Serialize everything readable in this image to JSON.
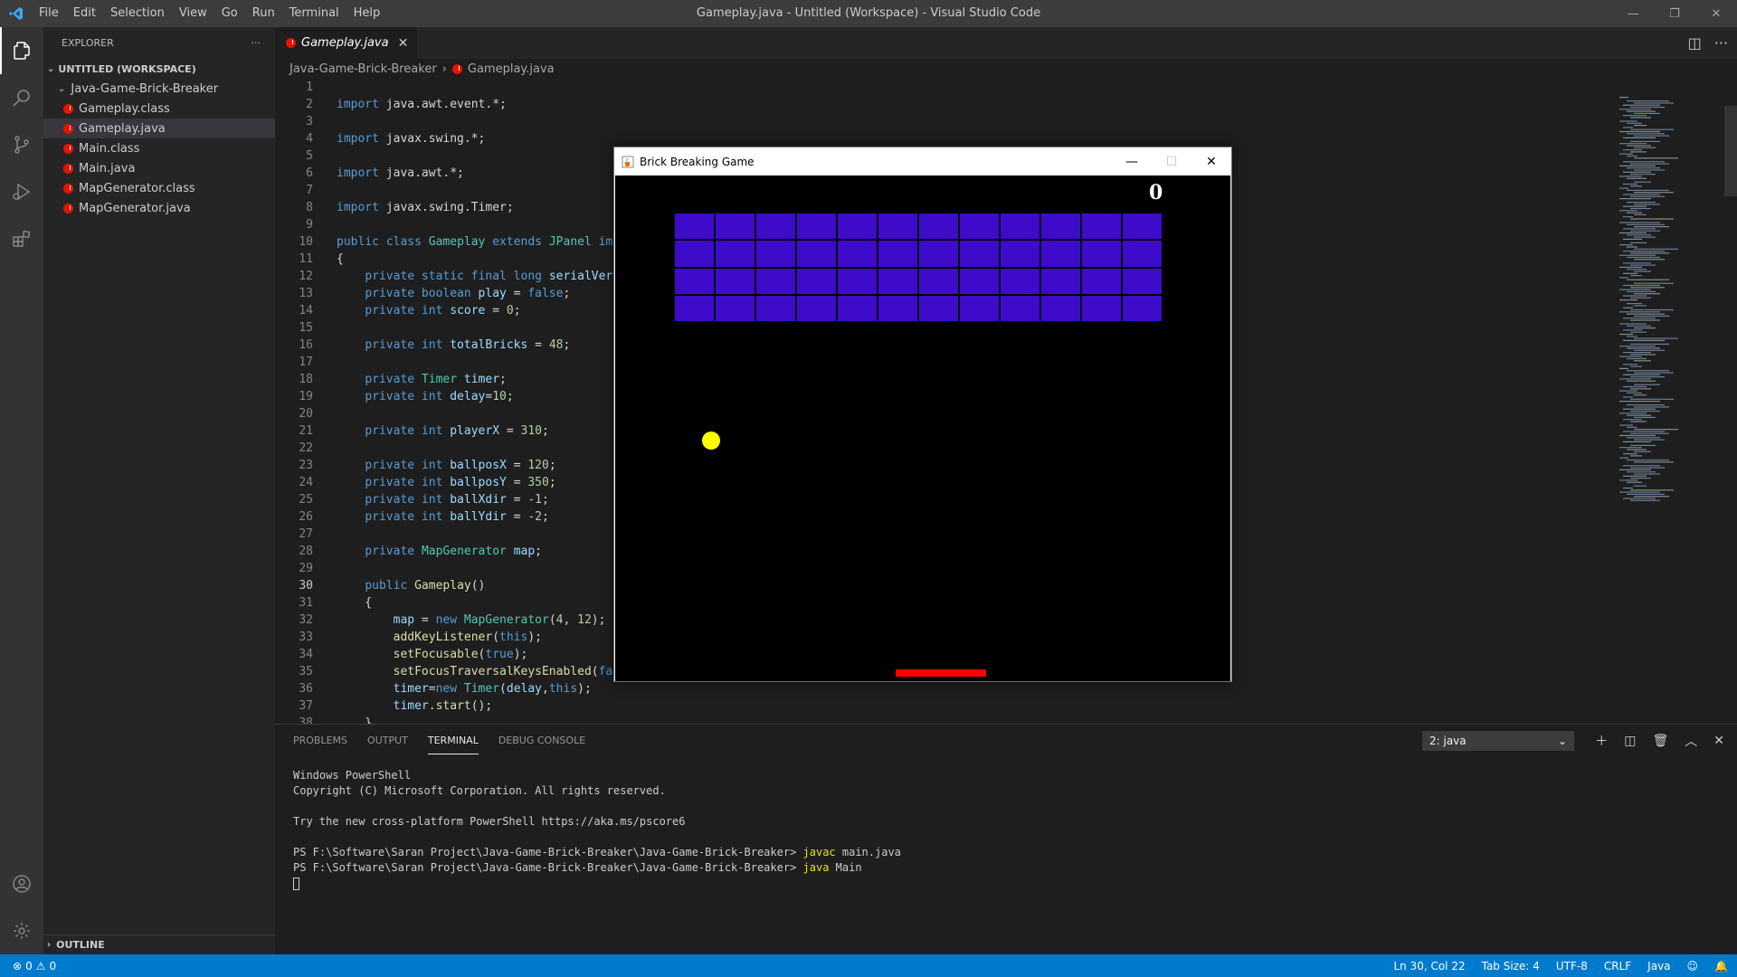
{
  "window": {
    "title": "Gameplay.java - Untitled (Workspace) - Visual Studio Code"
  },
  "menu": [
    "File",
    "Edit",
    "Selection",
    "View",
    "Go",
    "Run",
    "Terminal",
    "Help"
  ],
  "activity_bar": {
    "items": [
      "explorer-icon",
      "search-icon",
      "source-control-icon",
      "run-debug-icon",
      "extensions-icon"
    ],
    "bottom": [
      "account-icon",
      "settings-gear-icon"
    ]
  },
  "sidebar": {
    "header": "EXPLORER",
    "workspace": "UNTITLED (WORKSPACE)",
    "folder": "Java-Game-Brick-Breaker",
    "files": [
      "Gameplay.class",
      "Gameplay.java",
      "Main.class",
      "Main.java",
      "MapGenerator.class",
      "MapGenerator.java"
    ],
    "selected_file": "Gameplay.java",
    "outline": "OUTLINE"
  },
  "editor": {
    "tab": "Gameplay.java",
    "breadcrumb": [
      "Java-Game-Brick-Breaker",
      "Gameplay.java"
    ],
    "active_line": 30,
    "code": [
      {
        "n": "1",
        "t": []
      },
      {
        "n": "2",
        "t": [
          [
            "kw",
            "import"
          ],
          [
            "pl",
            " java.awt.event.*;"
          ]
        ]
      },
      {
        "n": "3",
        "t": []
      },
      {
        "n": "4",
        "t": [
          [
            "kw",
            "import"
          ],
          [
            "pl",
            " javax.swing.*;"
          ]
        ]
      },
      {
        "n": "5",
        "t": []
      },
      {
        "n": "6",
        "t": [
          [
            "kw",
            "import"
          ],
          [
            "pl",
            " java.awt.*;"
          ]
        ]
      },
      {
        "n": "7",
        "t": []
      },
      {
        "n": "8",
        "t": [
          [
            "kw",
            "import"
          ],
          [
            "pl",
            " javax.swing.Timer;"
          ]
        ]
      },
      {
        "n": "9",
        "t": []
      },
      {
        "n": "10",
        "t": [
          [
            "kw",
            "public"
          ],
          [
            "pl",
            " "
          ],
          [
            "kw",
            "class"
          ],
          [
            "pl",
            " "
          ],
          [
            "ty",
            "Gameplay"
          ],
          [
            "pl",
            " "
          ],
          [
            "kw",
            "extends"
          ],
          [
            "pl",
            " "
          ],
          [
            "ty",
            "JPanel"
          ],
          [
            "pl",
            " "
          ],
          [
            "kw",
            "imp"
          ]
        ]
      },
      {
        "n": "11",
        "t": [
          [
            "pl",
            "{"
          ]
        ]
      },
      {
        "n": "12",
        "t": [
          [
            "pl",
            "    "
          ],
          [
            "kw",
            "private static final long"
          ],
          [
            "pl",
            " "
          ],
          [
            "va",
            "serialVers"
          ]
        ]
      },
      {
        "n": "13",
        "t": [
          [
            "pl",
            "    "
          ],
          [
            "kw",
            "private boolean"
          ],
          [
            "pl",
            " "
          ],
          [
            "va",
            "play"
          ],
          [
            "pl",
            " = "
          ],
          [
            "kw",
            "false"
          ],
          [
            "pl",
            ";"
          ]
        ]
      },
      {
        "n": "14",
        "t": [
          [
            "pl",
            "    "
          ],
          [
            "kw",
            "private int"
          ],
          [
            "pl",
            " "
          ],
          [
            "va",
            "score"
          ],
          [
            "pl",
            " = "
          ],
          [
            "nu",
            "0"
          ],
          [
            "pl",
            ";"
          ]
        ]
      },
      {
        "n": "15",
        "t": []
      },
      {
        "n": "16",
        "t": [
          [
            "pl",
            "    "
          ],
          [
            "kw",
            "private int"
          ],
          [
            "pl",
            " "
          ],
          [
            "va",
            "totalBricks"
          ],
          [
            "pl",
            " = "
          ],
          [
            "nu",
            "48"
          ],
          [
            "pl",
            ";"
          ]
        ]
      },
      {
        "n": "17",
        "t": []
      },
      {
        "n": "18",
        "t": [
          [
            "pl",
            "    "
          ],
          [
            "kw",
            "private"
          ],
          [
            "pl",
            " "
          ],
          [
            "ty",
            "Timer"
          ],
          [
            "pl",
            " "
          ],
          [
            "va",
            "timer"
          ],
          [
            "pl",
            ";"
          ]
        ]
      },
      {
        "n": "19",
        "t": [
          [
            "pl",
            "    "
          ],
          [
            "kw",
            "private int"
          ],
          [
            "pl",
            " "
          ],
          [
            "va",
            "delay"
          ],
          [
            "pl",
            "="
          ],
          [
            "nu",
            "10"
          ],
          [
            "pl",
            ";"
          ]
        ]
      },
      {
        "n": "20",
        "t": []
      },
      {
        "n": "21",
        "t": [
          [
            "pl",
            "    "
          ],
          [
            "kw",
            "private int"
          ],
          [
            "pl",
            " "
          ],
          [
            "va",
            "playerX"
          ],
          [
            "pl",
            " = "
          ],
          [
            "nu",
            "310"
          ],
          [
            "pl",
            ";"
          ]
        ]
      },
      {
        "n": "22",
        "t": []
      },
      {
        "n": "23",
        "t": [
          [
            "pl",
            "    "
          ],
          [
            "kw",
            "private int"
          ],
          [
            "pl",
            " "
          ],
          [
            "va",
            "ballposX"
          ],
          [
            "pl",
            " = "
          ],
          [
            "nu",
            "120"
          ],
          [
            "pl",
            ";"
          ]
        ]
      },
      {
        "n": "24",
        "t": [
          [
            "pl",
            "    "
          ],
          [
            "kw",
            "private int"
          ],
          [
            "pl",
            " "
          ],
          [
            "va",
            "ballposY"
          ],
          [
            "pl",
            " = "
          ],
          [
            "nu",
            "350"
          ],
          [
            "pl",
            ";"
          ]
        ]
      },
      {
        "n": "25",
        "t": [
          [
            "pl",
            "    "
          ],
          [
            "kw",
            "private int"
          ],
          [
            "pl",
            " "
          ],
          [
            "va",
            "ballXdir"
          ],
          [
            "pl",
            " = "
          ],
          [
            "nu",
            "-1"
          ],
          [
            "pl",
            ";"
          ]
        ]
      },
      {
        "n": "26",
        "t": [
          [
            "pl",
            "    "
          ],
          [
            "kw",
            "private int"
          ],
          [
            "pl",
            " "
          ],
          [
            "va",
            "ballYdir"
          ],
          [
            "pl",
            " = "
          ],
          [
            "nu",
            "-2"
          ],
          [
            "pl",
            ";"
          ]
        ]
      },
      {
        "n": "27",
        "t": []
      },
      {
        "n": "28",
        "t": [
          [
            "pl",
            "    "
          ],
          [
            "kw",
            "private"
          ],
          [
            "pl",
            " "
          ],
          [
            "ty",
            "MapGenerator"
          ],
          [
            "pl",
            " "
          ],
          [
            "va",
            "map"
          ],
          [
            "pl",
            ";"
          ]
        ]
      },
      {
        "n": "29",
        "t": []
      },
      {
        "n": "30",
        "t": [
          [
            "pl",
            "    "
          ],
          [
            "kw",
            "public"
          ],
          [
            "pl",
            " "
          ],
          [
            "fn",
            "Gameplay"
          ],
          [
            "pl",
            "()"
          ]
        ]
      },
      {
        "n": "31",
        "t": [
          [
            "pl",
            "    {"
          ]
        ]
      },
      {
        "n": "32",
        "t": [
          [
            "pl",
            "        "
          ],
          [
            "va",
            "map"
          ],
          [
            "pl",
            " = "
          ],
          [
            "kw",
            "new"
          ],
          [
            "pl",
            " "
          ],
          [
            "ty",
            "MapGenerator"
          ],
          [
            "pl",
            "("
          ],
          [
            "nu",
            "4"
          ],
          [
            "pl",
            ", "
          ],
          [
            "nu",
            "12"
          ],
          [
            "pl",
            ");"
          ]
        ]
      },
      {
        "n": "33",
        "t": [
          [
            "pl",
            "        "
          ],
          [
            "fn",
            "addKeyListener"
          ],
          [
            "pl",
            "("
          ],
          [
            "kw",
            "this"
          ],
          [
            "pl",
            ");"
          ]
        ]
      },
      {
        "n": "34",
        "t": [
          [
            "pl",
            "        "
          ],
          [
            "fn",
            "setFocusable"
          ],
          [
            "pl",
            "("
          ],
          [
            "kw",
            "true"
          ],
          [
            "pl",
            ");"
          ]
        ]
      },
      {
        "n": "35",
        "t": [
          [
            "pl",
            "        "
          ],
          [
            "fn",
            "setFocusTraversalKeysEnabled"
          ],
          [
            "pl",
            "("
          ],
          [
            "kw",
            "fal"
          ]
        ]
      },
      {
        "n": "36",
        "t": [
          [
            "pl",
            "        "
          ],
          [
            "va",
            "timer"
          ],
          [
            "pl",
            "="
          ],
          [
            "kw",
            "new"
          ],
          [
            "pl",
            " "
          ],
          [
            "ty",
            "Timer"
          ],
          [
            "pl",
            "("
          ],
          [
            "va",
            "delay"
          ],
          [
            "pl",
            ","
          ],
          [
            "kw",
            "this"
          ],
          [
            "pl",
            ");"
          ]
        ]
      },
      {
        "n": "37",
        "t": [
          [
            "pl",
            "        "
          ],
          [
            "va",
            "timer"
          ],
          [
            "pl",
            "."
          ],
          [
            "fn",
            "start"
          ],
          [
            "pl",
            "();"
          ]
        ]
      },
      {
        "n": "38",
        "t": [
          [
            "pl",
            "    }"
          ]
        ]
      }
    ]
  },
  "panel": {
    "tabs": [
      "PROBLEMS",
      "OUTPUT",
      "TERMINAL",
      "DEBUG CONSOLE"
    ],
    "active_tab": "TERMINAL",
    "terminal_select": "2: java",
    "terminal_lines": [
      {
        "text": "Windows PowerShell"
      },
      {
        "text": "Copyright (C) Microsoft Corporation. All rights reserved."
      },
      {
        "text": ""
      },
      {
        "text": "Try the new cross-platform PowerShell https://aka.ms/pscore6"
      },
      {
        "text": ""
      },
      {
        "prompt": "PS F:\\Software\\Saran Project\\Java-Game-Brick-Breaker\\Java-Game-Brick-Breaker> ",
        "cmd": "javac",
        "args": " main.java"
      },
      {
        "prompt": "PS F:\\Software\\Saran Project\\Java-Game-Brick-Breaker\\Java-Game-Brick-Breaker> ",
        "cmd": "java",
        "args": " Main"
      }
    ]
  },
  "statusbar": {
    "errors": "0",
    "warnings": "0",
    "position": "Ln 30, Col 22",
    "tab_size": "Tab Size: 4",
    "encoding": "UTF-8",
    "eol": "CRLF",
    "language": "Java"
  },
  "game_window": {
    "title": "Brick Breaking Game",
    "score": "0",
    "brick_rows": 4,
    "brick_cols": 12,
    "brick_color": "#3d0bc9",
    "ball_color": "#ffff00",
    "paddle_color": "#ff0000"
  }
}
